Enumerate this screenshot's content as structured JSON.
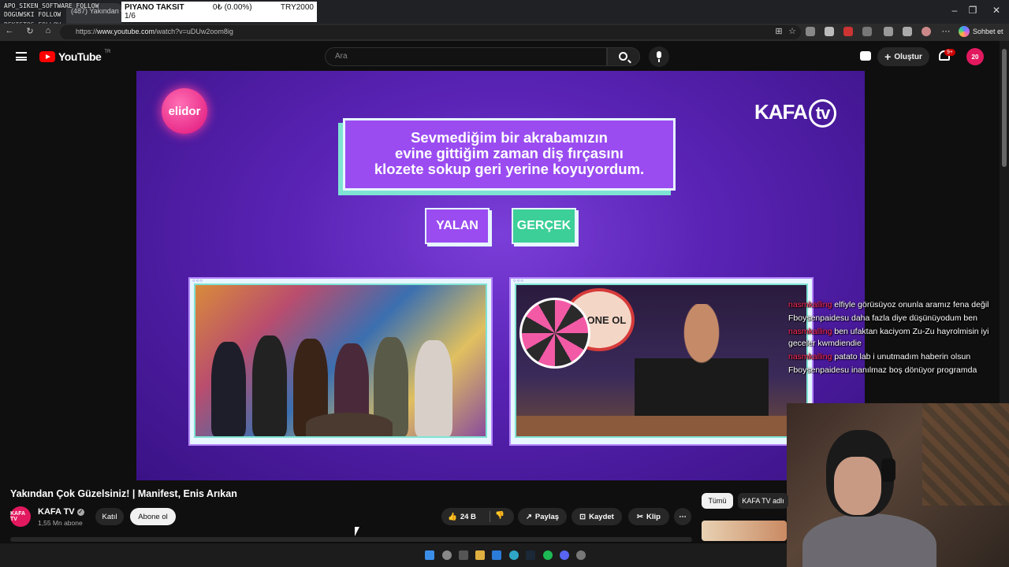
{
  "browser": {
    "tab_title": "(487) Yakından Çok",
    "url_prefix": "https://",
    "url_host": "www.youtube.com",
    "url_path": "/watch?v=uDUw2oom8ig",
    "chat_button": "Sohbet et",
    "window_controls": [
      "–",
      "❐",
      "✕"
    ]
  },
  "overlay": {
    "lines": [
      "APO_SIKEN_SOFTWARE",
      "FOLLOW",
      "DOGUWSKI FOLLOW",
      "REKISTOS FOLLOW"
    ],
    "ticker": {
      "symbol": "PIYANO TAKSIT",
      "change": "0₺ (0.00%)",
      "pair": "TRY2000",
      "page": "1/6"
    }
  },
  "youtube": {
    "logo_text": "YouTube",
    "country": "TR",
    "search_placeholder": "Ara",
    "create_label": "Oluştur",
    "notif_count": "9+",
    "avatar_text": "20"
  },
  "video": {
    "sponsor": "elidor",
    "brand": "KAFA",
    "brand_tv": "tv",
    "question_lines": [
      "Sevmediğim bir akrabamızın",
      "evine gittiğim zaman diş fırçasını",
      "klozete sokup geri yerine koyuyordum."
    ],
    "answer_false": "YALAN",
    "answer_true": "GERÇEK",
    "panel_dots": "○○○",
    "sign_text": "ABONE OL"
  },
  "chat": [
    {
      "user": "nasmkalling",
      "user_color": "red",
      "text": "elfiyle görüsüyoz onunla aramız fena değil"
    },
    {
      "user": "Fboysenpaidesu",
      "user_color": "white",
      "text": "daha fazla diye düşünüyodum ben"
    },
    {
      "user": "nasmkalling",
      "user_color": "red",
      "text": "ben ufaktan kaciyom Zu-Zu hayrolmisin iyi geceler kwmdiendie"
    },
    {
      "user": "nasmkalling",
      "user_color": "red",
      "text": "patato lab i unutmadım haberin olsun"
    },
    {
      "user": "Fboysenpaidesu",
      "user_color": "white",
      "text": "inanılmaz boş dönüyor programda"
    }
  ],
  "meta": {
    "title": "Yakından Çok Güzelsiniz! | Manifest, Enis Arıkan",
    "channel_avatar": "KAFA TV",
    "channel": "KAFA TV",
    "subscribers": "1,55 Mn abone",
    "join": "Katıl",
    "subscribe": "Abone ol",
    "likes": "24 B",
    "share": "Paylaş",
    "save": "Kaydet",
    "clip": "Klip",
    "more": "⋯",
    "chip_all": "Tümü",
    "chip_channel": "KAFA TV adlı"
  },
  "colors": {
    "video_purple": "#5a23b5",
    "question_bg": "#9a4cf1",
    "answer_true_bg": "#3ccf98",
    "accent_red": "#ff0000",
    "chat_red": "#ff2a55"
  }
}
